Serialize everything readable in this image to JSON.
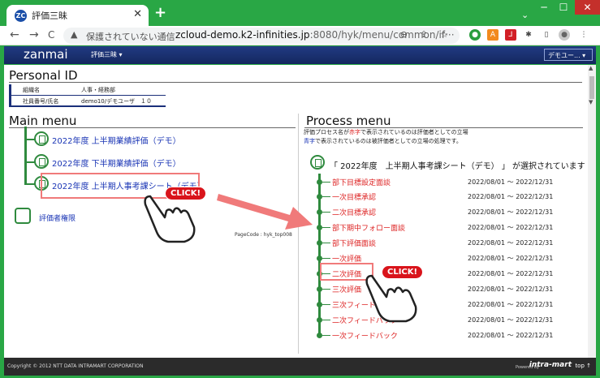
{
  "browser": {
    "tab_title": "評価三昧",
    "tab_favicon": "ZC",
    "close_glyph": "✕",
    "newtab_glyph": "+",
    "tab_dropdown": "⌄",
    "win_min": "─",
    "win_max": "☐",
    "win_close": "✕",
    "back": "←",
    "forward": "→",
    "reload": "C",
    "warn_glyph": "▲",
    "insecure": "保護されていない通信",
    "url_host": "zcloud-demo.k2-infinities.jp",
    "url_path": ":8080/hyk/menu/common/if···",
    "addr_icons": "⊖ ⇪ ☆",
    "extensions": [
      "●",
      "A",
      "⅃",
      "✱",
      "▯",
      "●",
      "⋮"
    ]
  },
  "app": {
    "brand": "zanmai",
    "menu_label": "評価三昧 ▾",
    "user_box": "デモユー... ▾"
  },
  "personal": {
    "heading": "Personal ID",
    "rows": [
      {
        "label": "組織名",
        "value": "人事・経務部"
      },
      {
        "label": "社員番号/氏名",
        "value": "demo10/デモユーザ　１０"
      }
    ]
  },
  "main_menu": {
    "heading": "Main menu",
    "items": [
      "2022年度 上半期業績評価（デモ）",
      "2022年度 下半期業績評価（デモ）",
      "2022年度 上半期人事考課シート（デモ）"
    ],
    "admin": "評価者権限",
    "page_code": "PageCode : hyk_top008"
  },
  "process_menu": {
    "heading": "Process menu",
    "legend1_pre": "評価プロセス名が",
    "legend1_red": "赤字",
    "legend1_post": "で表示されているのは評価者としての立場",
    "legend2_blue": "青字",
    "legend2_post": "で表示されているのは被評価者としての立場の処理です。",
    "selected_message": "「 2022年度　上半期人事考課シート（デモ） 」 が選択されています",
    "items": [
      {
        "label": "部下目標設定面談",
        "dates": "2022/08/01 ～ 2022/12/31"
      },
      {
        "label": "一次目標承認",
        "dates": "2022/08/01 ～ 2022/12/31"
      },
      {
        "label": "二次目標承認",
        "dates": "2022/08/01 ～ 2022/12/31"
      },
      {
        "label": "部下期中フォロー面談",
        "dates": "2022/08/01 ～ 2022/12/31"
      },
      {
        "label": "部下評価面談",
        "dates": "2022/08/01 ～ 2022/12/31"
      },
      {
        "label": "一次評価",
        "dates": "2022/08/01 ～ 2022/12/31"
      },
      {
        "label": "二次評価",
        "dates": "2022/08/01 ～ 2022/12/31"
      },
      {
        "label": "三次評価",
        "dates": "2022/08/01 ～ 2022/12/31"
      },
      {
        "label": "三次フィードバック",
        "dates": "2022/08/01 ～ 2022/12/31"
      },
      {
        "label": "二次フィードバック",
        "dates": "2022/08/01 ～ 2022/12/31"
      },
      {
        "label": "一次フィードバック",
        "dates": "2022/08/01 ～ 2022/12/31"
      }
    ]
  },
  "annotations": {
    "click_label": "CLICK!"
  },
  "footer": {
    "copyright": "Copyright © 2012 NTT DATA INTRAMART CORPORATION",
    "powered": "Powered by",
    "logo": "intra-mart",
    "top": "top ↑"
  },
  "scrollbar": {
    "up": "▲",
    "down": "▼"
  },
  "colors": {
    "browser_green": "#29a745",
    "header_navy": "#1a2f7a",
    "link_blue": "#1a35b5",
    "process_red": "#d22",
    "click_red": "#d9141b"
  }
}
